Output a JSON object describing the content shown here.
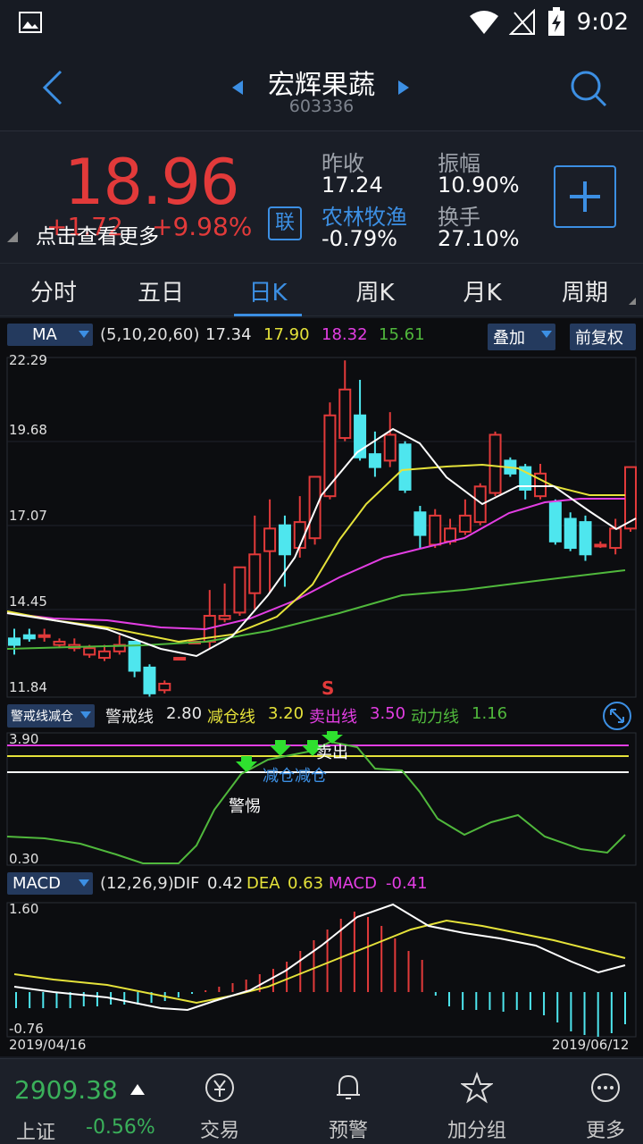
{
  "status_bar": {
    "time": "9:02"
  },
  "header": {
    "stock_name": "宏辉果蔬",
    "stock_code": "603336"
  },
  "quote": {
    "price": "18.96",
    "change": "+1.72",
    "change_pct": "+9.98%",
    "overlay_tip": "点击查看更多",
    "link_badge": "联",
    "prev_close_label": "昨收",
    "prev_close": "17.24",
    "amplitude_label": "振幅",
    "amplitude": "10.90%",
    "sector_label": "农林牧渔",
    "sector_change": "-0.79%",
    "turnover_label": "换手",
    "turnover": "27.10%"
  },
  "tabs": [
    {
      "label": "分时"
    },
    {
      "label": "五日"
    },
    {
      "label": "日K"
    },
    {
      "label": "周K"
    },
    {
      "label": "月K"
    },
    {
      "label": "周期"
    }
  ],
  "ma_bar": {
    "selector": "MA",
    "params": "(5,10,20,60)",
    "ma5": "17.34",
    "ma10": "17.90",
    "ma20": "18.32",
    "ma60": "15.61",
    "overlay_btn": "叠加",
    "adjust_btn": "前复权"
  },
  "main_axis": {
    "labels": [
      "22.29",
      "19.68",
      "17.07",
      "14.45",
      "11.84"
    ],
    "signal": "S"
  },
  "warn_bar": {
    "selector": "警戒线减仓",
    "l1": "警戒线",
    "v1": "2.80",
    "l2": "减仓线",
    "v2": "3.20",
    "l3": "卖出线",
    "v3": "3.50",
    "l4": "动力线",
    "v4": "1.16"
  },
  "warn_axis": {
    "top": "3.90",
    "bottom": "0.30"
  },
  "warn_notes": {
    "sell": "卖出",
    "reduce": "减仓减仓",
    "alert": "警惕"
  },
  "macd_bar": {
    "selector": "MACD",
    "params": "(12,26,9)",
    "dif_label": "DIF",
    "dif": "0.42",
    "dea_label": "DEA",
    "dea": "0.63",
    "macd_label": "MACD",
    "macd": "-0.41"
  },
  "macd_axis": {
    "top": "1.60",
    "bottom": "-0.76"
  },
  "dates": {
    "start": "2019/04/16",
    "end": "2019/06/12"
  },
  "bottom_bar": {
    "index_value": "2909.38",
    "index_name": "上证",
    "index_change": "-0.56%",
    "items": [
      {
        "label": "交易"
      },
      {
        "label": "预警"
      },
      {
        "label": "加分组"
      },
      {
        "label": "更多"
      }
    ]
  },
  "chart_data": {
    "type": "candlestick",
    "ylim": [
      11.84,
      22.29
    ],
    "candles": [
      [
        13.6,
        13.4,
        13.9,
        13.1
      ],
      [
        13.7,
        13.6,
        13.9,
        13.5
      ],
      [
        13.7,
        13.7,
        13.9,
        13.5
      ],
      [
        13.4,
        13.5,
        13.6,
        13.3
      ],
      [
        13.3,
        13.4,
        13.6,
        13.2
      ],
      [
        13.1,
        13.3,
        13.4,
        13.0
      ],
      [
        13.0,
        13.2,
        13.4,
        12.9
      ],
      [
        13.2,
        13.4,
        13.7,
        13.1
      ],
      [
        13.5,
        12.6,
        13.5,
        12.4
      ],
      [
        12.7,
        11.9,
        12.8,
        11.8
      ],
      [
        12.0,
        12.2,
        12.3,
        11.9
      ],
      [
        13.0,
        13.0,
        13.0,
        13.0
      ],
      [
        13.5,
        13.5,
        13.5,
        13.5
      ],
      [
        13.5,
        14.3,
        15.1,
        13.3
      ],
      [
        14.2,
        14.3,
        15.3,
        14.1
      ],
      [
        14.4,
        15.8,
        15.8,
        14.3
      ],
      [
        15.0,
        16.2,
        17.4,
        14.5
      ],
      [
        16.3,
        17.0,
        17.9,
        15.0
      ],
      [
        17.1,
        16.2,
        17.4,
        15.2
      ],
      [
        16.4,
        17.2,
        18.0,
        16.1
      ],
      [
        16.7,
        18.6,
        18.6,
        16.5
      ],
      [
        18.0,
        20.5,
        20.9,
        17.9
      ],
      [
        19.8,
        21.3,
        22.2,
        19.7
      ],
      [
        20.5,
        19.2,
        21.6,
        19.1
      ],
      [
        19.3,
        18.9,
        20.0,
        18.6
      ],
      [
        19.1,
        19.9,
        20.6,
        18.9
      ],
      [
        19.6,
        18.2,
        19.7,
        18.1
      ],
      [
        17.5,
        16.8,
        17.7,
        16.4
      ],
      [
        16.5,
        17.4,
        17.6,
        16.4
      ],
      [
        16.6,
        17.0,
        17.3,
        16.5
      ],
      [
        16.9,
        17.4,
        17.9,
        16.8
      ],
      [
        17.2,
        18.3,
        18.4,
        17.1
      ],
      [
        18.1,
        19.9,
        20.0,
        18.0
      ],
      [
        19.1,
        18.7,
        19.2,
        18.6
      ],
      [
        18.9,
        18.2,
        19.0,
        17.9
      ],
      [
        18.0,
        18.7,
        19.0,
        17.9
      ],
      [
        17.8,
        16.6,
        17.9,
        16.5
      ],
      [
        17.3,
        16.4,
        17.5,
        16.3
      ],
      [
        17.2,
        16.2,
        17.4,
        16.0
      ],
      [
        16.5,
        16.5,
        16.6,
        16.4
      ],
      [
        16.4,
        17.0,
        17.3,
        16.2
      ],
      [
        17.0,
        18.9,
        18.9,
        16.9
      ]
    ]
  }
}
